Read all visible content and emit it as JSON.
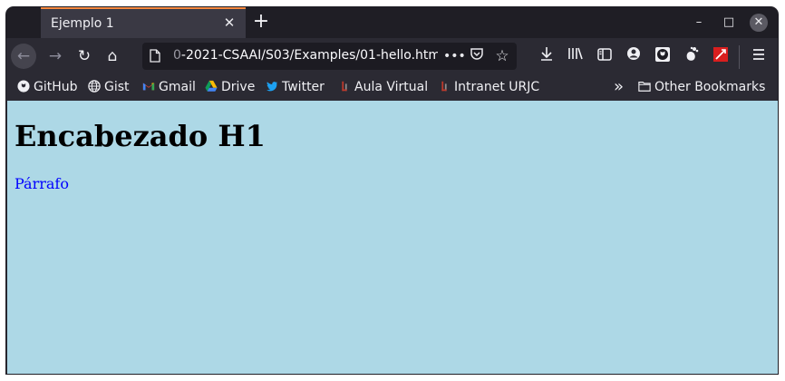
{
  "tab": {
    "title": "Ejemplo 1",
    "close": "✕"
  },
  "new_tab": "+",
  "window_controls": {
    "minimize": "–",
    "maximize": "□",
    "close": "✕"
  },
  "nav": {
    "back": "←",
    "forward": "→",
    "reload": "↻",
    "home": "⌂"
  },
  "urlbar": {
    "url_fade": "0",
    "url_text": "-2021-CSAAI/S03/Examples/01-hello.htm",
    "dots": "•••"
  },
  "bookmarks": [
    {
      "label": "GitHub",
      "icon": "github-icon"
    },
    {
      "label": "Gist",
      "icon": "globe-icon"
    },
    {
      "label": "Gmail",
      "icon": "gmail-icon"
    },
    {
      "label": "Drive",
      "icon": "drive-icon"
    },
    {
      "label": "Twitter",
      "icon": "twitter-icon"
    },
    {
      "label": "Aula Virtual",
      "icon": "urjc-icon"
    },
    {
      "label": "Intranet URJC",
      "icon": "urjc-icon"
    }
  ],
  "bookmarks_overflow": "»",
  "other_bookmarks": "Other Bookmarks",
  "page": {
    "heading": "Encabezado H1",
    "paragraph": "Párrafo"
  },
  "colors": {
    "page_background": "#add8e6",
    "paragraph": "#0000ff",
    "tab_accent": "#f5893f"
  }
}
